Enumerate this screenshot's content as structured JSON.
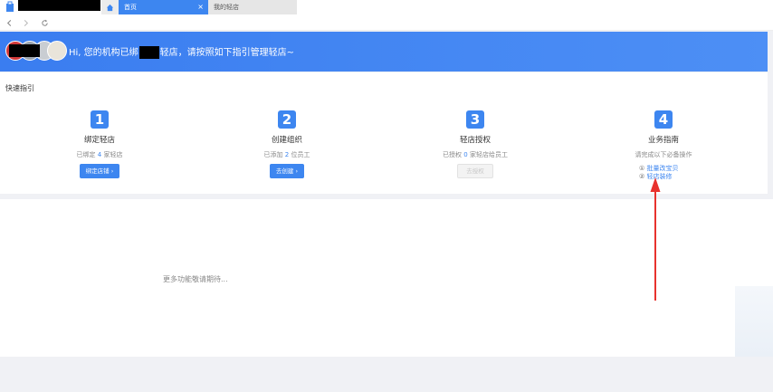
{
  "tabs": {
    "active_label": "首页",
    "close_glyph": "×",
    "inactive_label": "我的轻店"
  },
  "banner": {
    "greeting_prefix": "Hi, 您的机构已绑",
    "greeting_suffix": "轻店，请按照如下指引管理轻店~"
  },
  "guide": {
    "title": "快速指引",
    "steps": [
      {
        "num": "1",
        "title": "绑定轻店",
        "desc_prefix": "已绑定 ",
        "desc_num": "4",
        "desc_suffix": " 家轻店",
        "button": "绑定店铺 ›"
      },
      {
        "num": "2",
        "title": "创建组织",
        "desc_prefix": "已添加 ",
        "desc_num": "2",
        "desc_suffix": " 位员工",
        "button": "去创建 ›"
      },
      {
        "num": "3",
        "title": "轻店授权",
        "desc_prefix": "已授权 ",
        "desc_num": "0",
        "desc_suffix": " 家轻店给员工",
        "button": "去授权"
      },
      {
        "num": "4",
        "title": "业务指南",
        "desc": "请完成以下必备操作",
        "links": [
          {
            "idx": "①",
            "label": "批量改宝贝"
          },
          {
            "idx": "②",
            "label": "轻店装修"
          }
        ]
      }
    ]
  },
  "lower": {
    "more_text": "更多功能敬请期待..."
  },
  "colors": {
    "accent": "#3d86f0",
    "annotation_arrow": "#e8322e"
  },
  "icons": [
    "app-icon",
    "home-icon",
    "back-icon",
    "forward-icon",
    "refresh-icon",
    "red-arrow-annotation"
  ]
}
